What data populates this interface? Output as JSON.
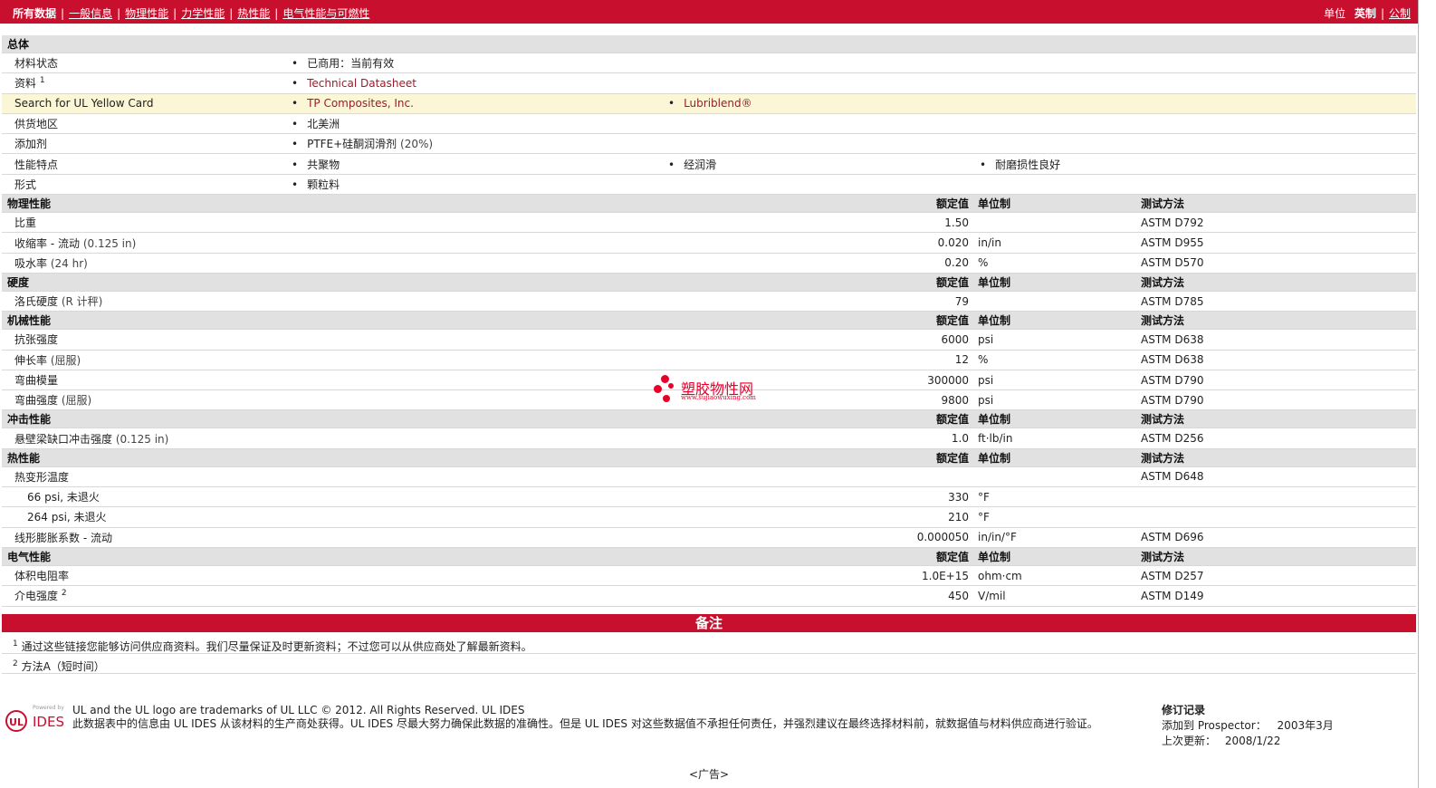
{
  "nav": {
    "items": [
      "所有数据",
      "一般信息",
      "物理性能",
      "力学性能",
      "热性能",
      "电气性能与可燃性"
    ],
    "unit_label": "单位",
    "unit_imperial": "英制",
    "unit_metric": "公制"
  },
  "general": {
    "section_title": "总体",
    "status_label": "材料状态",
    "status_value": "已商用：当前有效",
    "docs_label": "资料",
    "docs_sup": "1",
    "docs_link": "Technical Datasheet",
    "ul_label": "Search for UL Yellow Card",
    "ul_link1": "TP Composites, Inc.",
    "ul_link2": "Lubriblend®",
    "region_label": "供货地区",
    "region_value": "北美洲",
    "additive_label": "添加剂",
    "additive_value": "PTFE+硅酮润滑剂",
    "additive_pct": "(20%)",
    "feature_label": "性能特点",
    "feature1": "共聚物",
    "feature2": "经润滑",
    "feature3": "耐磨损性良好",
    "form_label": "形式",
    "form_value": "颗粒料"
  },
  "headers": {
    "nominal": "额定值",
    "unit": "单位制",
    "method": "测试方法"
  },
  "physical": {
    "title": "物理性能",
    "r1_name": "比重",
    "r1_val": "1.50",
    "r1_unit": "",
    "r1_method": "ASTM D792",
    "r2_name": "收缩率",
    "r2_cond": "- 流动",
    "r2_cond2": "(0.125 in)",
    "r2_val": "0.020",
    "r2_unit": "in/in",
    "r2_method": "ASTM D955",
    "r3_name": "吸水率",
    "r3_cond": "(24 hr)",
    "r3_val": "0.20",
    "r3_unit": "%",
    "r3_method": "ASTM D570"
  },
  "hardness": {
    "title": "硬度",
    "r1_name": "洛氏硬度",
    "r1_cond": "(R 计秤)",
    "r1_val": "79",
    "r1_method": "ASTM D785"
  },
  "mechanical": {
    "title": "机械性能",
    "r1_name": "抗张强度",
    "r1_val": "6000",
    "r1_unit": "psi",
    "r1_method": "ASTM D638",
    "r2_name": "伸长率",
    "r2_cond": "(屈服)",
    "r2_val": "12",
    "r2_unit": "%",
    "r2_method": "ASTM D638",
    "r3_name": "弯曲模量",
    "r3_val": "300000",
    "r3_unit": "psi",
    "r3_method": "ASTM D790",
    "r4_name": "弯曲强度",
    "r4_cond": "(屈服)",
    "r4_val": "9800",
    "r4_unit": "psi",
    "r4_method": "ASTM D790"
  },
  "impact": {
    "title": "冲击性能",
    "r1_name": "悬壁梁缺口冲击强度",
    "r1_cond": "(0.125 in)",
    "r1_val": "1.0",
    "r1_unit": "ft·lb/in",
    "r1_method": "ASTM D256"
  },
  "thermal": {
    "title": "热性能",
    "r1_name": "热变形温度",
    "r1_method": "ASTM D648",
    "r2_name": "66 psi, 未退火",
    "r2_val": "330",
    "r2_unit": "°F",
    "r3_name": "264 psi, 未退火",
    "r3_val": "210",
    "r3_unit": "°F",
    "r4_name": "线形膨胀系数",
    "r4_cond": "- 流动",
    "r4_val": "0.000050",
    "r4_unit": "in/in/°F",
    "r4_method": "ASTM D696"
  },
  "electrical": {
    "title": "电气性能",
    "r1_name": "体积电阻率",
    "r1_val": "1.0E+15",
    "r1_unit": "ohm·cm",
    "r1_method": "ASTM D257",
    "r2_name": "介电强度",
    "r2_sup": "2",
    "r2_val": "450",
    "r2_unit": "V/mil",
    "r2_method": "ASTM D149"
  },
  "notes": {
    "title": "备注",
    "n1_sup": "1",
    "n1": "通过这些链接您能够访问供应商资料。我们尽量保证及时更新资料；不过您可以从供应商处了解最新资料。",
    "n2_sup": "2",
    "n2": "方法A（短时间）"
  },
  "footer": {
    "logo_powered": "Powered by",
    "logo_ul": "UL",
    "logo_ides": "IDES",
    "line1": "UL and the UL logo are trademarks of UL LLC © 2012. All Rights Reserved. UL IDES",
    "line2": "此数据表中的信息由  UL IDES 从该材料的生产商处获得。UL IDES 尽最大努力确保此数据的准确性。但是  UL IDES 对这些数据值不承担任何责任，并强烈建议在最终选择材料前，就数据值与材料供应商进行验证。",
    "rev_title": "修订记录",
    "rev_added_label": "添加到",
    "rev_added_source": "Prospector：",
    "rev_added_date": "2003年3月",
    "rev_updated_label": "上次更新：",
    "rev_updated_date": "2008/1/22"
  },
  "ad": "<广告>",
  "watermark": {
    "text": "塑胶物性网",
    "url": "www.sujiaowuxing.com"
  }
}
